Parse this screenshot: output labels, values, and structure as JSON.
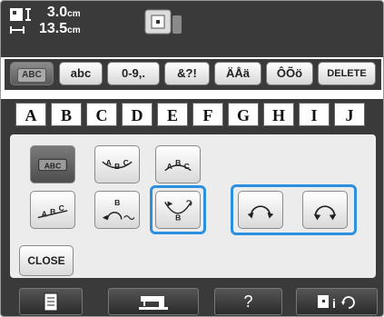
{
  "status": {
    "height_value": "3.0",
    "height_unit": "cm",
    "width_value": "13.5",
    "width_unit": "cm",
    "size_icon": "pattern-size-icon",
    "frame_icon": "embroidery-frame-icon"
  },
  "font_tabs": [
    {
      "label": "ABC",
      "selected": true
    },
    {
      "label": "abc",
      "selected": false
    },
    {
      "label": "0-9,.",
      "selected": false
    },
    {
      "label": "&?!",
      "selected": false
    },
    {
      "label": "ÄÅä",
      "selected": false
    },
    {
      "label": "ÔÕö",
      "selected": false
    },
    {
      "label": "DELETE",
      "selected": false
    }
  ],
  "letters": [
    "A",
    "B",
    "C",
    "D",
    "E",
    "F",
    "G",
    "H",
    "I",
    "J"
  ],
  "layout_options": {
    "row1": [
      {
        "icon": "straight-layout-icon",
        "text": "ABC",
        "selected": true
      },
      {
        "icon": "arc-up-layout-icon",
        "text": "ABC",
        "selected": false
      },
      {
        "icon": "arc-down-small-layout-icon",
        "text": "ABC",
        "selected": false
      }
    ],
    "row2": [
      {
        "icon": "diagonal-layout-icon",
        "text": "ABC",
        "selected": false
      },
      {
        "icon": "circle-top-layout-icon",
        "text": "B",
        "selected": false
      },
      {
        "icon": "circle-bottom-layout-icon",
        "text": "B",
        "selected": false
      },
      {
        "icon": "curve-tighter-icon",
        "selected": false
      },
      {
        "icon": "curve-wider-icon",
        "selected": false
      }
    ],
    "close_label": "CLOSE"
  },
  "bottom_bar": [
    {
      "icon": "document-icon"
    },
    {
      "icon": "sewing-machine-icon"
    },
    {
      "icon": "help-icon",
      "label": "?"
    },
    {
      "icon": "embroidery-info-icon"
    }
  ],
  "colors": {
    "highlight": "#2c8fe0",
    "bar": "#3a3a3a"
  }
}
